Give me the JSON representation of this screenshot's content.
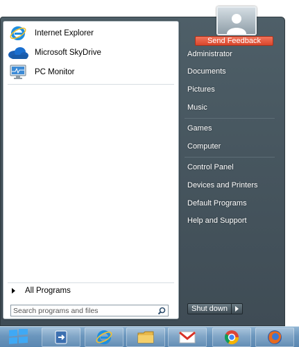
{
  "pinned_programs": [
    {
      "label": "Internet Explorer",
      "icon": "internet-explorer-icon"
    },
    {
      "label": "Microsoft SkyDrive",
      "icon": "skydrive-cloud-icon"
    },
    {
      "label": "PC Monitor",
      "icon": "monitor-icon"
    }
  ],
  "all_programs_label": "All Programs",
  "search": {
    "placeholder": "Search programs and files"
  },
  "user": {
    "feedback_label": "Send Feedback"
  },
  "right_links": [
    "Administrator",
    "Documents",
    "Pictures",
    "Music",
    "Games",
    "Computer",
    "Control Panel",
    "Devices and Printers",
    "Default Programs",
    "Help and Support"
  ],
  "shutdown_label": "Shut down",
  "taskbar_icons": [
    "windows-logo-icon",
    "file-transfer-icon",
    "internet-explorer-icon",
    "folder-icon",
    "gmail-icon",
    "chrome-icon",
    "firefox-icon"
  ],
  "colors": {
    "feedback": "#e2563b",
    "right_pane": "#46555e",
    "taskbar": "#6b96bd"
  }
}
